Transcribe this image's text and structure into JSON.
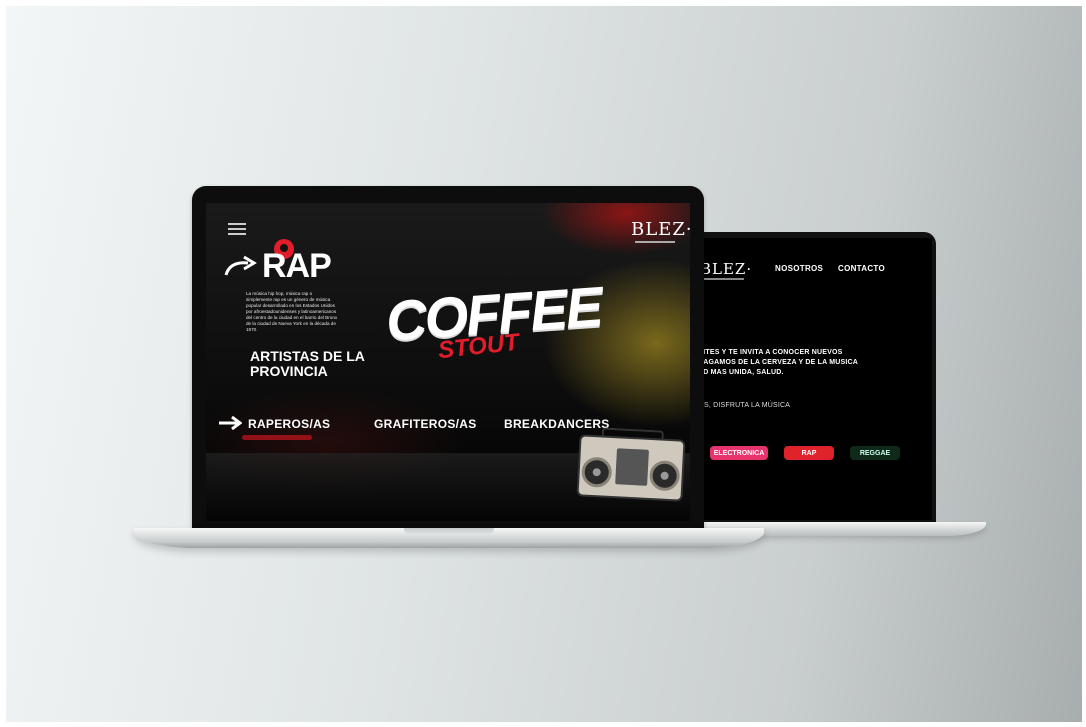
{
  "back_site": {
    "logo": "BLEZ·",
    "nav": [
      "NOSOTROS",
      "CONTACTO"
    ],
    "intro_lines": [
      "RITES Y TE INVITA A CONOCER NUEVOS",
      "HAGAMOS DE LA CERVEZA Y DE LA MUSICA",
      "AD MAS UNIDA, SALUD."
    ],
    "subline": "TOS, DISFRUTA LA MÚSICA",
    "genres": [
      {
        "label": "ELECTRONICA",
        "color": "#e8336d"
      },
      {
        "label": "RAP",
        "color": "#e0232b"
      },
      {
        "label": "REGGAE",
        "color": "#0f2a18"
      }
    ]
  },
  "front_site": {
    "logo": "BLEZ·",
    "section_title": "RAP",
    "description": "La música hip hop, música rap o simplemente rap es un género de música popular desarrollado en los Estados Unidos por afroestadounidenses y latinoamericanos del centro de la ciudad en el barrio del Bronx de la ciudad de Nueva York en la década de 1970.",
    "artists_heading": "ARTISTAS DE LA PROVINCIA",
    "hero_word": "COFFEE",
    "hero_sub": "STOUT",
    "categories": [
      "RAPEROS/AS",
      "GRAFITEROS/AS",
      "BREAKDANCERS"
    ],
    "accent": "#e11d2a"
  }
}
